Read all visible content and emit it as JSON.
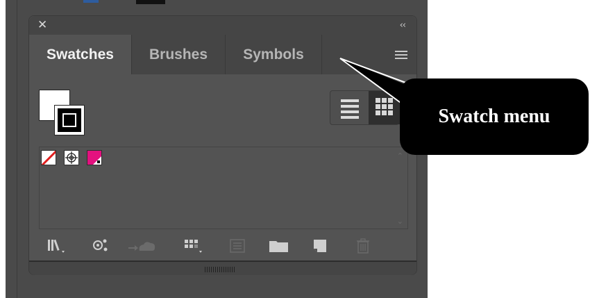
{
  "panel": {
    "tabs": [
      {
        "label": "Swatches",
        "active": true
      },
      {
        "label": "Brushes",
        "active": false
      },
      {
        "label": "Symbols",
        "active": false
      }
    ],
    "colors": {
      "panel_bg": "#535353",
      "tab_bar_bg": "#454545",
      "app_bg": "#4a4a4a",
      "magenta_swatch": "#e3117f",
      "none_swatch_slash": "#e02020"
    },
    "swatches": [
      {
        "name": "none-swatch"
      },
      {
        "name": "registration-swatch"
      },
      {
        "name": "magenta-swatch"
      }
    ],
    "toolbar_icons": [
      "swatch-libraries-icon",
      "show-swatch-kinds-icon",
      "cloud-library-icon",
      "swatch-options-icon",
      "color-group-icon",
      "new-folder-icon",
      "new-swatch-icon",
      "delete-swatch-icon"
    ]
  },
  "callout": {
    "text": "Swatch menu"
  }
}
